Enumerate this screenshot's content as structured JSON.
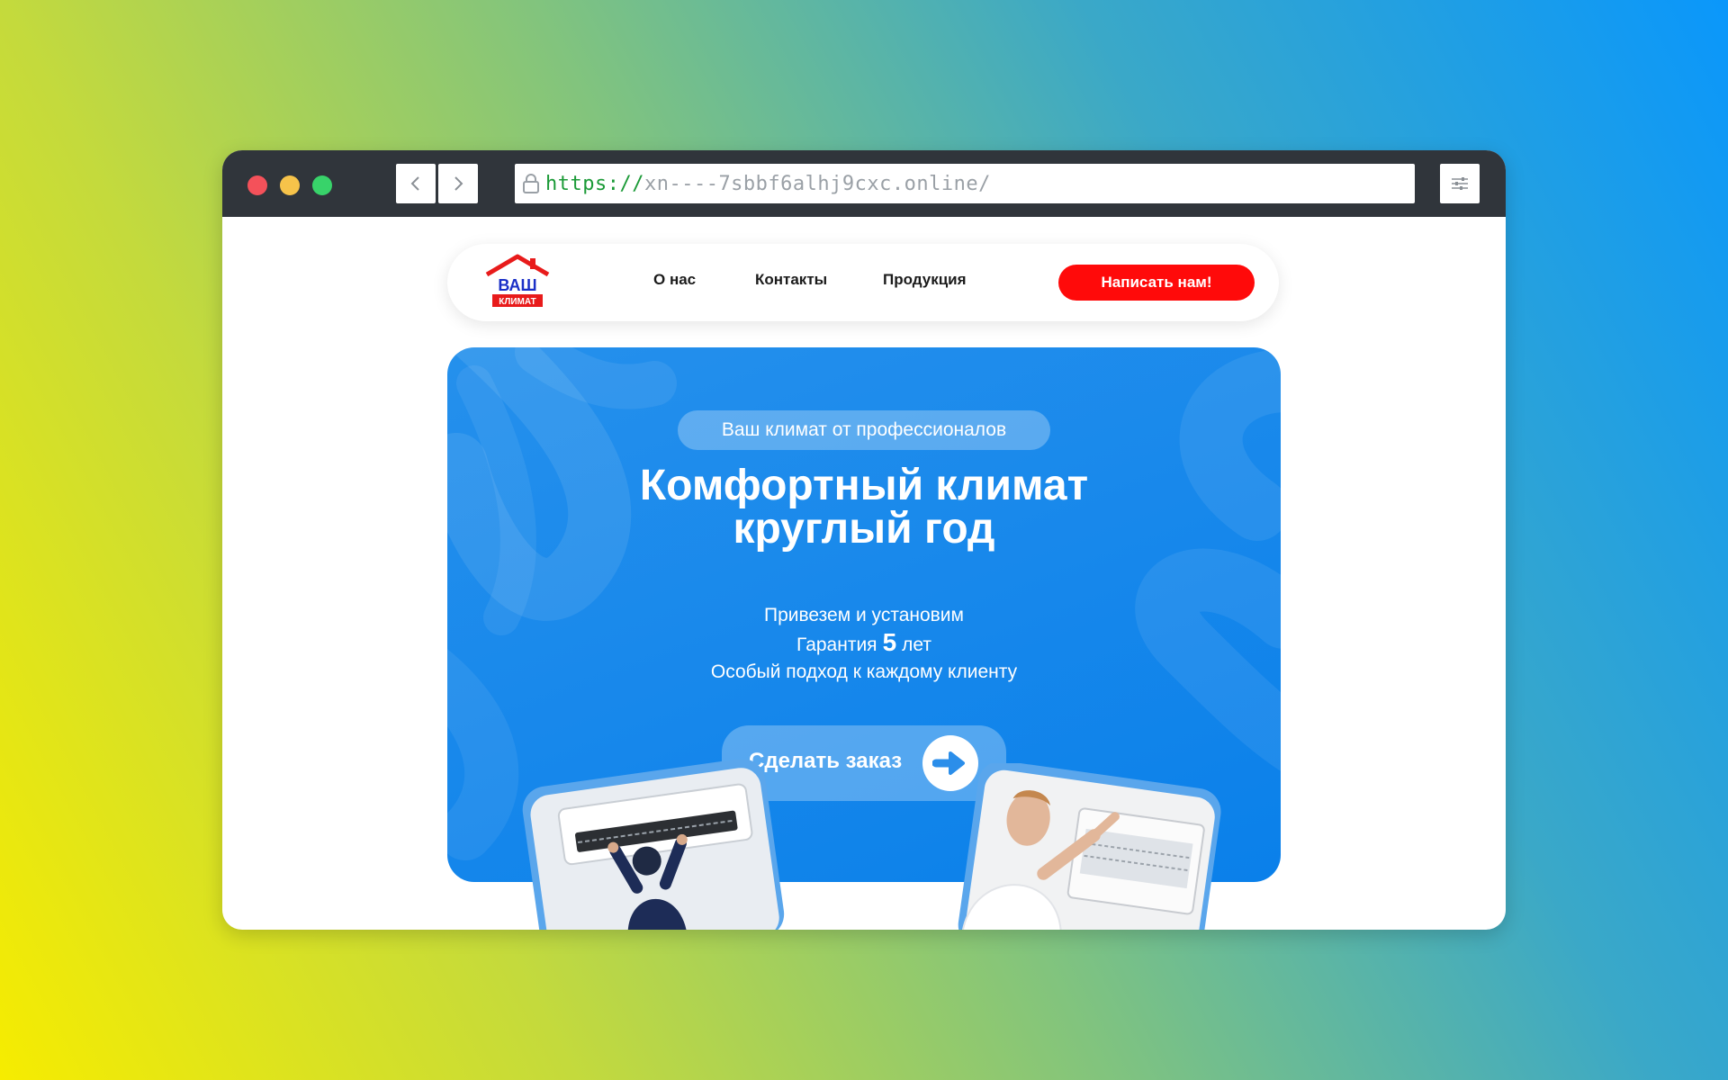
{
  "browser": {
    "url_protocol": "https://",
    "url_host": "xn----7sbbf6alhj9cxc.online/"
  },
  "header": {
    "logo_top": "ВАШ",
    "logo_bottom": "КЛИМАТ",
    "nav": [
      {
        "label": "О нас"
      },
      {
        "label": "Контакты"
      },
      {
        "label": "Продукция"
      }
    ],
    "cta_label": "Написать нам!"
  },
  "hero": {
    "badge": "Ваш климат от профессионалов",
    "title_line1": "Комфортный климат",
    "title_line2": "круглый год",
    "feature1": "Привезем и установим",
    "warranty_prefix": "Гарантия",
    "warranty_years": "5",
    "warranty_suffix": "лет",
    "feature3": "Особый подход к каждому клиенту",
    "order_label": "Сделать заказ"
  },
  "colors": {
    "accent_red": "#ff0a0a",
    "hero_blue": "#0a80ea",
    "chrome_dark": "#30353b"
  }
}
